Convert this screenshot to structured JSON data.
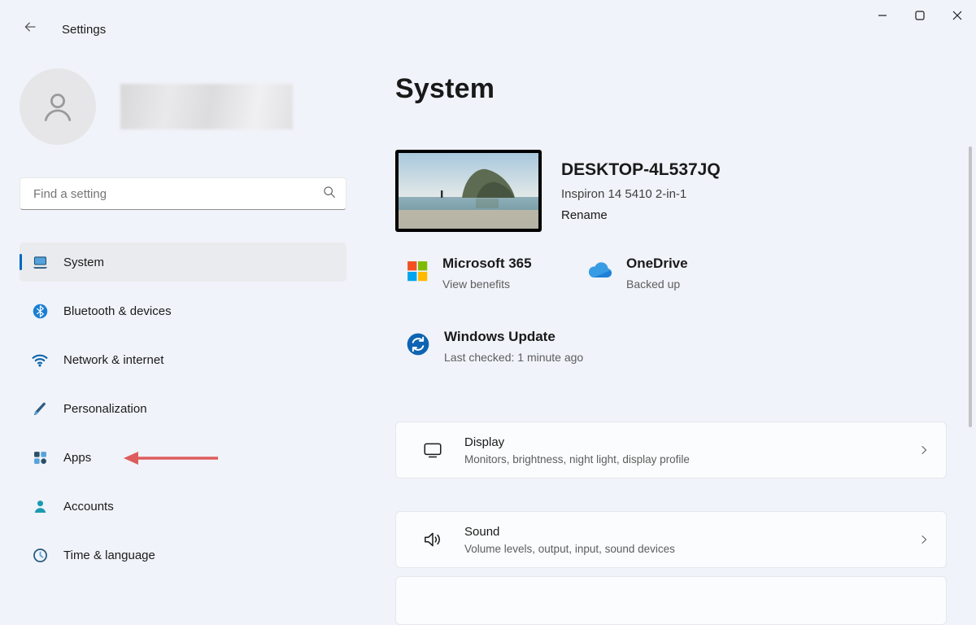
{
  "titlebar": {
    "title": "Settings"
  },
  "search": {
    "placeholder": "Find a setting"
  },
  "sidebar": {
    "items": [
      {
        "label": "System",
        "selected": true
      },
      {
        "label": "Bluetooth & devices"
      },
      {
        "label": "Network & internet"
      },
      {
        "label": "Personalization"
      },
      {
        "label": "Apps",
        "annotated": true
      },
      {
        "label": "Accounts"
      },
      {
        "label": "Time & language"
      }
    ]
  },
  "main": {
    "page_title": "System",
    "device": {
      "name": "DESKTOP-4L537JQ",
      "model": "Inspiron 14 5410 2-in-1",
      "rename_label": "Rename"
    },
    "quick_links": [
      {
        "title": "Microsoft 365",
        "subtitle": "View benefits"
      },
      {
        "title": "OneDrive",
        "subtitle": "Backed up"
      },
      {
        "title": "Windows Update",
        "subtitle": "Last checked: 1 minute ago"
      }
    ],
    "settings_cards": [
      {
        "title": "Display",
        "subtitle": "Monitors, brightness, night light, display profile"
      },
      {
        "title": "Sound",
        "subtitle": "Volume levels, output, input, sound devices"
      }
    ]
  },
  "colors": {
    "accent": "#0067c0",
    "annotation_arrow": "#dd5c5c",
    "ms_logo_red": "#f25022",
    "ms_logo_green": "#7fba00",
    "ms_logo_blue": "#00a4ef",
    "ms_logo_yellow": "#ffb900"
  }
}
